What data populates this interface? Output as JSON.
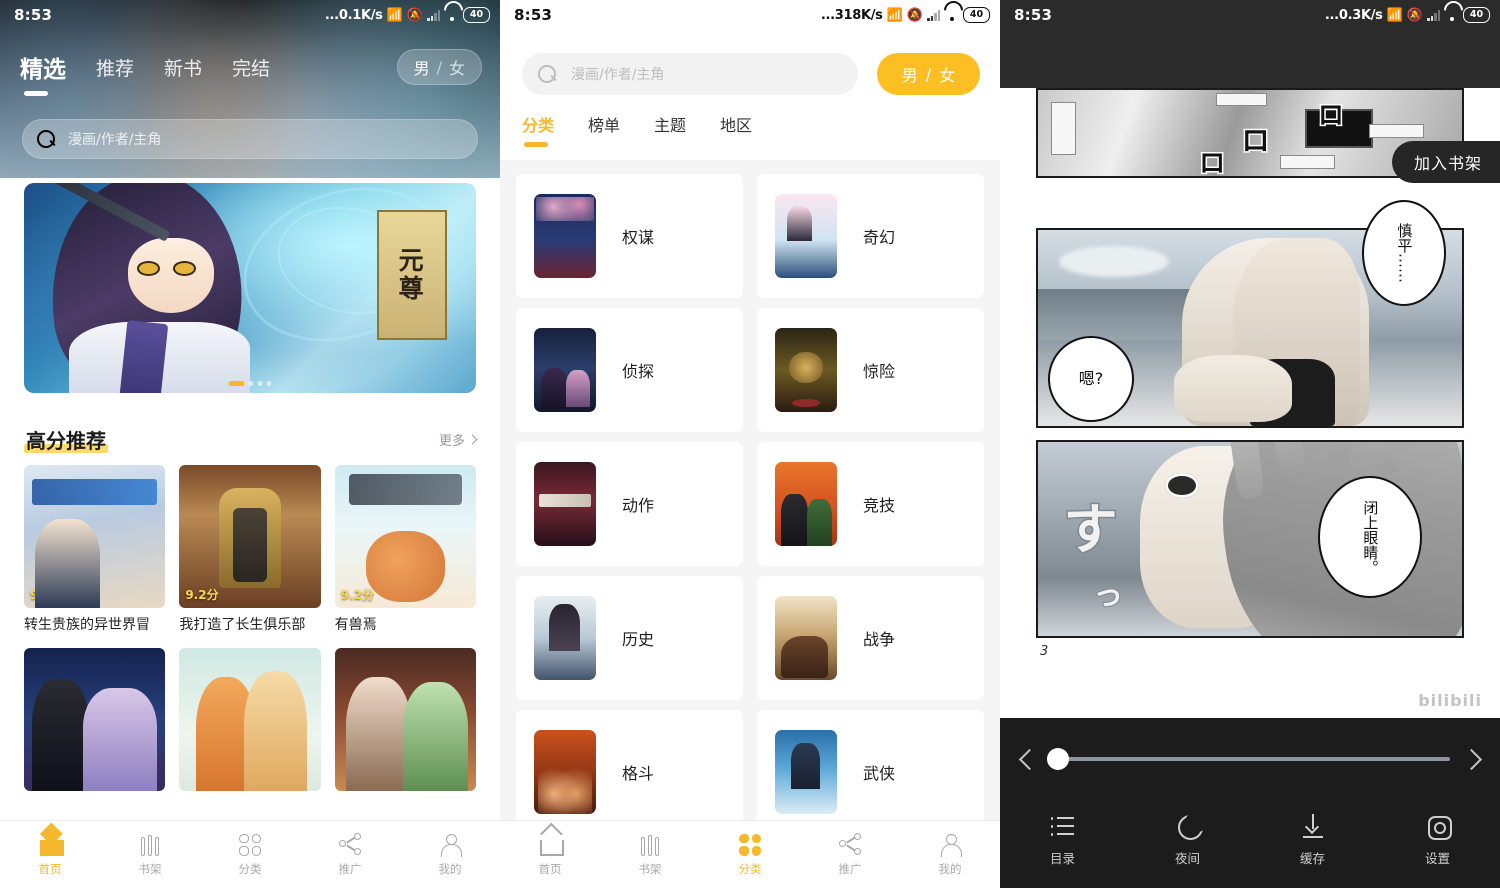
{
  "panels": {
    "home": {
      "status": {
        "clock": "8:53",
        "net_speed": "...0.1K/s",
        "battery": "40",
        "bluetooth_icon": "bluetooth-icon",
        "mute_icon": "bell-muted-icon",
        "signal_icon": "signal-bars-icon",
        "wifi_icon": "wifi-icon"
      },
      "tabs": [
        {
          "label": "精选",
          "active": true
        },
        {
          "label": "推荐",
          "active": false
        },
        {
          "label": "新书",
          "active": false
        },
        {
          "label": "完结",
          "active": false
        }
      ],
      "gender_toggle": {
        "male": "男",
        "sep": "/",
        "female": "女"
      },
      "search": {
        "placeholder": "漫画/作者/主角",
        "icon": "search-icon"
      },
      "banner": {
        "title_char1": "元",
        "title_char2": "尊"
      },
      "section": {
        "title": "高分推荐",
        "more": "更多"
      },
      "books": [
        {
          "title": "转生贵族的异世界冒",
          "score": "9.1分"
        },
        {
          "title": "我打造了长生俱乐部",
          "score": "9.2分"
        },
        {
          "title": "有兽焉",
          "score": "9.2分"
        },
        {
          "title": "",
          "score": ""
        },
        {
          "title": "",
          "score": ""
        },
        {
          "title": "",
          "score": ""
        }
      ],
      "tabbar": [
        {
          "label": "首页",
          "icon": "home-icon",
          "active": true
        },
        {
          "label": "书架",
          "icon": "bookshelf-icon",
          "active": false
        },
        {
          "label": "分类",
          "icon": "grid-icon",
          "active": false
        },
        {
          "label": "推广",
          "icon": "share-icon",
          "active": false
        },
        {
          "label": "我的",
          "icon": "user-icon",
          "active": false
        }
      ]
    },
    "category": {
      "status": {
        "clock": "8:53",
        "net_speed": "...318K/s",
        "battery": "40"
      },
      "search": {
        "placeholder": "漫画/作者/主角",
        "icon": "search-icon"
      },
      "gender_toggle": {
        "male": "男",
        "sep": "/",
        "female": "女"
      },
      "tabs": [
        {
          "label": "分类",
          "active": true
        },
        {
          "label": "榜单",
          "active": false
        },
        {
          "label": "主题",
          "active": false
        },
        {
          "label": "地区",
          "active": false
        }
      ],
      "items": [
        {
          "name": "权谋"
        },
        {
          "name": "奇幻"
        },
        {
          "name": "侦探"
        },
        {
          "name": "惊险"
        },
        {
          "name": "动作"
        },
        {
          "name": "竞技"
        },
        {
          "name": "历史"
        },
        {
          "name": "战争"
        },
        {
          "name": "格斗"
        },
        {
          "name": "武侠"
        }
      ],
      "tabbar": [
        {
          "label": "首页",
          "icon": "home-icon",
          "active": false
        },
        {
          "label": "书架",
          "icon": "bookshelf-icon",
          "active": false
        },
        {
          "label": "分类",
          "icon": "grid-icon",
          "active": true
        },
        {
          "label": "推广",
          "icon": "share-icon",
          "active": false
        },
        {
          "label": "我的",
          "icon": "user-icon",
          "active": false
        }
      ]
    },
    "reader": {
      "status": {
        "clock": "8:53",
        "net_speed": "...0.3K/s",
        "battery": "40"
      },
      "topbar": {
        "back_icon": "back-chevron-icon",
        "refresh_icon": "refresh-icon",
        "more_icon": "more-dots-icon"
      },
      "add_bookshelf": "加入书架",
      "bubbles": [
        "慎平……",
        "嗯?",
        "闭上眼睛。"
      ],
      "page_number": "3",
      "watermark": "bilibili",
      "slider": {
        "prev_icon": "chevron-left-icon",
        "next_icon": "chevron-right-icon",
        "progress_percent": "3"
      },
      "tools": [
        {
          "label": "目录",
          "icon": "list-icon"
        },
        {
          "label": "夜间",
          "icon": "moon-icon"
        },
        {
          "label": "缓存",
          "icon": "download-icon"
        },
        {
          "label": "设置",
          "icon": "gear-icon"
        }
      ]
    }
  },
  "colors": {
    "accent": "#f5b82e",
    "accent_solid": "#fbbf24",
    "bg_gray": "#f5f5f5",
    "reader_bar": "#1c1c1c",
    "reader_top": "#2b2b2b"
  }
}
